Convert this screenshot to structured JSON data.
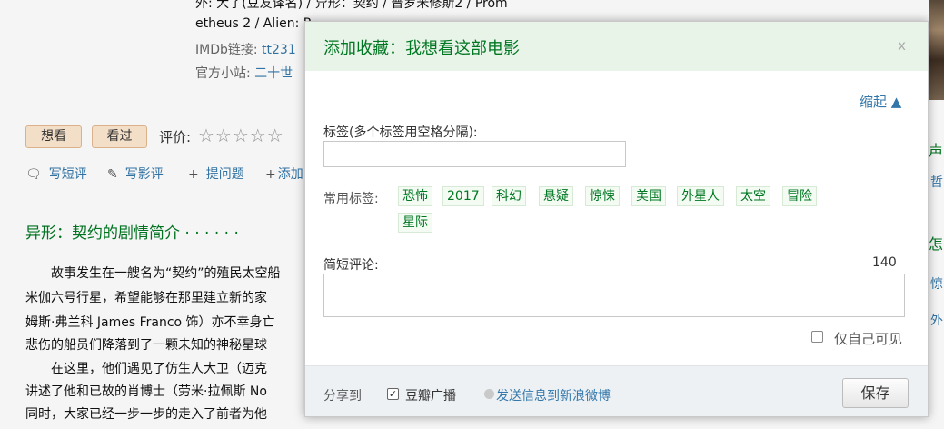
{
  "page": {
    "meta_partial_line": "外: 大了(豆友译名) / 异形：契约 / 普罗米修斯2 / Prom",
    "aka_line2": "etheus 2 / Alien: P",
    "imdb_label": "IMDb链接:",
    "imdb_value": "tt231",
    "site_label": "官方小站:",
    "site_value": "二十世",
    "want_button": "想看",
    "seen_button": "看过",
    "rating_label": "评价:",
    "stars": "☆☆☆☆☆",
    "actions": [
      {
        "icon": "comment-icon",
        "glyph": "🗨",
        "label": "写短评"
      },
      {
        "icon": "pencil-icon",
        "glyph": "✎",
        "label": "写影评"
      },
      {
        "icon": "plus-icon",
        "glyph": "+",
        "label": "提问题"
      },
      {
        "icon": "plus-icon",
        "glyph": "+",
        "label": "添加"
      }
    ],
    "synopsis_title": "异形：契约的剧情简介 · · · · · ·",
    "synopsis_lines": [
      "　　故事发生在一艘名为“契约”的殖民太空船",
      "米伽六号行星，希望能够在那里建立新的家",
      "姆斯·弗兰科 James Franco 饰）亦不幸身亡",
      "悲伤的船员们降落到了一颗未知的神秘星球",
      "　　在这里，他们遇见了仿生人大卫（迈克",
      "讲述了他和已故的肖博士（劳米·拉佩斯 No",
      "同时，大家已经一步一步的走入了前者为他"
    ],
    "right_edge": {
      "text1": "声",
      "link1": "哲",
      "text2": "怎",
      "link2": "惊",
      "link3": "外"
    }
  },
  "dialog": {
    "title": "添加收藏：我想看这部电影",
    "close": "x",
    "collapse": "缩起 ▲",
    "tags_label": "标签(多个标签用空格分隔):",
    "tags_value": "",
    "common_tags_label": "常用标签:",
    "common_tags": [
      "恐怖",
      "2017",
      "科幻",
      "悬疑",
      "惊悚",
      "美国",
      "外星人",
      "太空",
      "冒险",
      "星际"
    ],
    "comment_label": "简短评论:",
    "char_count": "140",
    "comment_value": "",
    "private_label": "仅自己可见",
    "share_label": "分享到",
    "broadcast_label": "豆瓣广播",
    "broadcast_checked": "✓",
    "weibo_label": "发送信息到新浪微博",
    "save_button": "保存"
  }
}
